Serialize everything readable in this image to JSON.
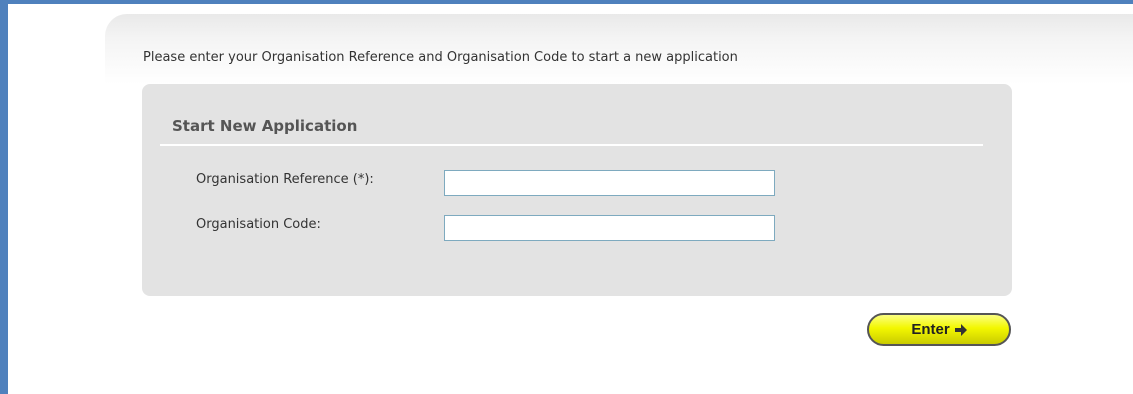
{
  "intro_text": "Please enter your Organisation Reference and Organisation Code to start a new application",
  "form": {
    "title": "Start New Application",
    "fields": [
      {
        "label": "Organisation Reference (*):",
        "value": ""
      },
      {
        "label": "Organisation Code:",
        "value": ""
      }
    ]
  },
  "enter_button": {
    "label": "Enter",
    "icon": "arrow-right-icon"
  },
  "colors": {
    "frame": "#4f81bd",
    "form_background": "#e3e3e3",
    "button": "#f3f700",
    "input_border": "#7eaabf"
  }
}
